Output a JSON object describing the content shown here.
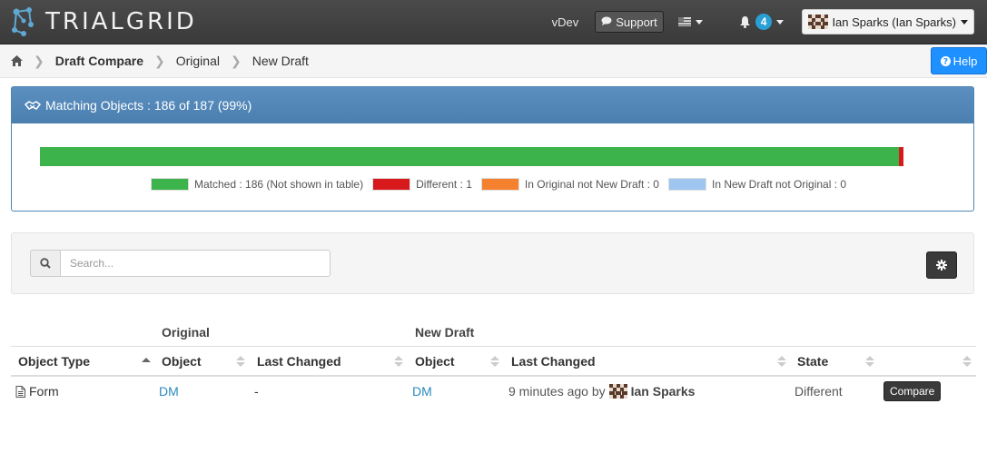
{
  "navbar": {
    "brand": "TRIALGRID",
    "env": "vDev",
    "support_label": "Support",
    "notification_count": "4",
    "user_label": "Ian Sparks (Ian Sparks)"
  },
  "breadcrumb": {
    "items": [
      "Draft Compare",
      "Original",
      "New Draft"
    ],
    "help_label": "Help"
  },
  "summary": {
    "title": "Matching Objects : 186 of 187 (99%)",
    "counts": {
      "matched": 186,
      "different": 1,
      "in_original_not_new": 0,
      "in_new_not_original": 0
    },
    "legend": [
      {
        "label": "Matched : 186 (Not shown in table)",
        "color": "#3cb44b"
      },
      {
        "label": "Different : 1",
        "color": "#d7191c"
      },
      {
        "label": "In Original not New Draft : 0",
        "color": "#f5812e"
      },
      {
        "label": "In New Draft not Original : 0",
        "color": "#9ec6f0"
      }
    ]
  },
  "search": {
    "placeholder": "Search..."
  },
  "table": {
    "group_headers": {
      "original": "Original",
      "new_draft": "New Draft"
    },
    "columns": [
      "Object Type",
      "Object",
      "Last Changed",
      "Object",
      "Last Changed",
      "State"
    ],
    "rows": [
      {
        "object_type": "Form",
        "original_object": "DM",
        "original_last_changed": "-",
        "new_object": "DM",
        "new_last_changed": "9 minutes ago by",
        "new_changed_user": "Ian Sparks",
        "state": "Different",
        "action_label": "Compare"
      }
    ]
  }
}
